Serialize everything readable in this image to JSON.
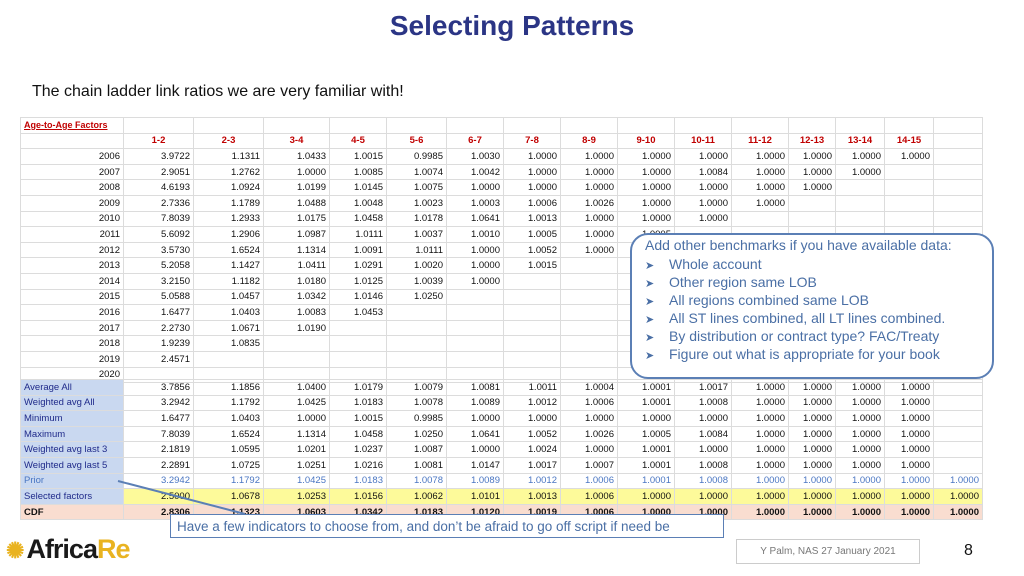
{
  "title": "Selecting Patterns",
  "subtitle": "The chain ladder link ratios we are very familiar with!",
  "table": {
    "label": "Age-to-Age Factors",
    "headers": [
      "1-2",
      "2-3",
      "3-4",
      "4-5",
      "5-6",
      "6-7",
      "7-8",
      "8-9",
      "9-10",
      "10-11",
      "11-12",
      "12-13",
      "13-14",
      "14-15"
    ],
    "rows": [
      {
        "year": "2006",
        "values": [
          "3.9722",
          "1.1311",
          "1.0433",
          "1.0015",
          "0.9985",
          "1.0030",
          "1.0000",
          "1.0000",
          "1.0000",
          "1.0000",
          "1.0000",
          "1.0000",
          "1.0000",
          "1.0000"
        ]
      },
      {
        "year": "2007",
        "values": [
          "2.9051",
          "1.2762",
          "1.0000",
          "1.0085",
          "1.0074",
          "1.0042",
          "1.0000",
          "1.0000",
          "1.0000",
          "1.0084",
          "1.0000",
          "1.0000",
          "1.0000"
        ]
      },
      {
        "year": "2008",
        "values": [
          "4.6193",
          "1.0924",
          "1.0199",
          "1.0145",
          "1.0075",
          "1.0000",
          "1.0000",
          "1.0000",
          "1.0000",
          "1.0000",
          "1.0000",
          "1.0000"
        ]
      },
      {
        "year": "2009",
        "values": [
          "2.7336",
          "1.1789",
          "1.0488",
          "1.0048",
          "1.0023",
          "1.0003",
          "1.0006",
          "1.0026",
          "1.0000",
          "1.0000",
          "1.0000"
        ]
      },
      {
        "year": "2010",
        "values": [
          "7.8039",
          "1.2933",
          "1.0175",
          "1.0458",
          "1.0178",
          "1.0641",
          "1.0013",
          "1.0000",
          "1.0000",
          "1.0000"
        ]
      },
      {
        "year": "2011",
        "values": [
          "5.6092",
          "1.2906",
          "1.0987",
          "1.0111",
          "1.0037",
          "1.0010",
          "1.0005",
          "1.0000",
          "1.0005"
        ]
      },
      {
        "year": "2012",
        "values": [
          "3.5730",
          "1.6524",
          "1.1314",
          "1.0091",
          "1.0111",
          "1.0000",
          "1.0052",
          "1.0000"
        ]
      },
      {
        "year": "2013",
        "values": [
          "5.2058",
          "1.1427",
          "1.0411",
          "1.0291",
          "1.0020",
          "1.0000",
          "1.0015"
        ]
      },
      {
        "year": "2014",
        "values": [
          "3.2150",
          "1.1182",
          "1.0180",
          "1.0125",
          "1.0039",
          "1.0000"
        ]
      },
      {
        "year": "2015",
        "values": [
          "5.0588",
          "1.0457",
          "1.0342",
          "1.0146",
          "1.0250"
        ]
      },
      {
        "year": "2016",
        "values": [
          "1.6477",
          "1.0403",
          "1.0083",
          "1.0453"
        ]
      },
      {
        "year": "2017",
        "values": [
          "2.2730",
          "1.0671",
          "1.0190"
        ]
      },
      {
        "year": "2018",
        "values": [
          "1.9239",
          "1.0835"
        ]
      },
      {
        "year": "2019",
        "values": [
          "2.4571"
        ]
      },
      {
        "year": "2020",
        "values": []
      }
    ]
  },
  "summary": [
    {
      "label": "Average All",
      "values": [
        "3.7856",
        "1.1856",
        "1.0400",
        "1.0179",
        "1.0079",
        "1.0081",
        "1.0011",
        "1.0004",
        "1.0001",
        "1.0017",
        "1.0000",
        "1.0000",
        "1.0000",
        "1.0000",
        ""
      ]
    },
    {
      "label": "Weighted avg All",
      "values": [
        "3.2942",
        "1.1792",
        "1.0425",
        "1.0183",
        "1.0078",
        "1.0089",
        "1.0012",
        "1.0006",
        "1.0001",
        "1.0008",
        "1.0000",
        "1.0000",
        "1.0000",
        "1.0000",
        ""
      ]
    },
    {
      "label": "Minimum",
      "values": [
        "1.6477",
        "1.0403",
        "1.0000",
        "1.0015",
        "0.9985",
        "1.0000",
        "1.0000",
        "1.0000",
        "1.0000",
        "1.0000",
        "1.0000",
        "1.0000",
        "1.0000",
        "1.0000",
        ""
      ]
    },
    {
      "label": "Maximum",
      "values": [
        "7.8039",
        "1.6524",
        "1.1314",
        "1.0458",
        "1.0250",
        "1.0641",
        "1.0052",
        "1.0026",
        "1.0005",
        "1.0084",
        "1.0000",
        "1.0000",
        "1.0000",
        "1.0000",
        ""
      ]
    },
    {
      "label": "Weighted avg last 3",
      "values": [
        "2.1819",
        "1.0595",
        "1.0201",
        "1.0237",
        "1.0087",
        "1.0000",
        "1.0024",
        "1.0000",
        "1.0001",
        "1.0000",
        "1.0000",
        "1.0000",
        "1.0000",
        "1.0000",
        ""
      ]
    },
    {
      "label": "Weighted avg last 5",
      "values": [
        "2.2891",
        "1.0725",
        "1.0251",
        "1.0216",
        "1.0081",
        "1.0147",
        "1.0017",
        "1.0007",
        "1.0001",
        "1.0008",
        "1.0000",
        "1.0000",
        "1.0000",
        "1.0000",
        ""
      ]
    },
    {
      "label": "Prior",
      "values": [
        "3.2942",
        "1.1792",
        "1.0425",
        "1.0183",
        "1.0078",
        "1.0089",
        "1.0012",
        "1.0006",
        "1.0001",
        "1.0008",
        "1.0000",
        "1.0000",
        "1.0000",
        "1.0000",
        "1.0000"
      ]
    },
    {
      "label": "Selected factors",
      "values": [
        "2.5000",
        "1.0678",
        "1.0253",
        "1.0156",
        "1.0062",
        "1.0101",
        "1.0013",
        "1.0006",
        "1.0000",
        "1.0000",
        "1.0000",
        "1.0000",
        "1.0000",
        "1.0000",
        "1.0000"
      ]
    },
    {
      "label": "CDF",
      "values": [
        "2.8306",
        "1.1323",
        "1.0603",
        "1.0342",
        "1.0183",
        "1.0120",
        "1.0019",
        "1.0006",
        "1.0000",
        "1.0000",
        "1.0000",
        "1.0000",
        "1.0000",
        "1.0000",
        "1.0000"
      ]
    }
  ],
  "benchmarks": {
    "heading": "Add other benchmarks if you have available data:",
    "items": [
      "Whole account",
      "Other region same LOB",
      "All regions combined same LOB",
      "All ST lines combined, all LT lines combined.",
      "By distribution or contract type? FAC/Treaty",
      "Figure out what is appropriate for your book"
    ]
  },
  "indicators_note": "Have a few indicators to choose from, and don’t be afraid to go off script if need be",
  "logo": {
    "text_main": "Africa",
    "text_accent": "Re"
  },
  "footer": "Y Palm, NAS 27 January 2021",
  "page_number": "8",
  "colors": {
    "title": "#2b3585",
    "header_red": "#c00000",
    "selected_yellow": "#fdfa9a",
    "cdf_peach": "#f9ddd0",
    "callout_blue": "#5b7fb5"
  }
}
